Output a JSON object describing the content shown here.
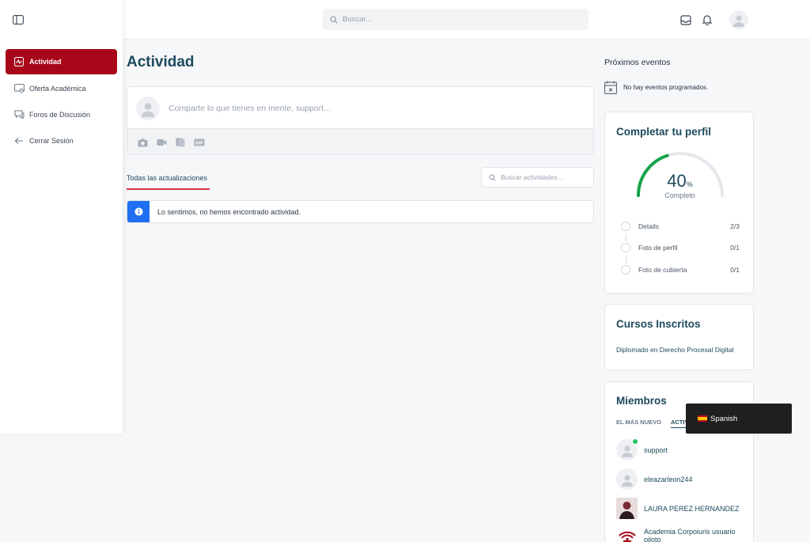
{
  "header": {
    "search_placeholder": "Buscar..."
  },
  "sidebar": {
    "items": [
      {
        "label": "Actividad",
        "icon": "activity-icon",
        "active": true
      },
      {
        "label": "Oferta Académica",
        "icon": "school-icon",
        "active": false
      },
      {
        "label": "Foros de Discusión",
        "icon": "chat-icon",
        "active": false
      },
      {
        "label": "Cerrar Sesión",
        "icon": "arrow-left-icon",
        "active": false
      }
    ]
  },
  "main": {
    "title": "Actividad",
    "post_placeholder": "Comparte lo que tienes en mente, support...",
    "tab_label": "Todas las actualizaciones",
    "search_activity_placeholder": "Buscar actividades...",
    "alert_text": "Lo sentimos, no hemos encontrado actividad."
  },
  "events": {
    "title": "Próximos eventos",
    "empty_text": "No hay eventos programados."
  },
  "profile": {
    "title": "Completar tu perfil",
    "percent": "40",
    "percent_sign": "%",
    "sub": "Completo",
    "progress_fraction": 0.4,
    "steps": [
      {
        "label": "Details",
        "count": "2/3"
      },
      {
        "label": "Foto de perfil",
        "count": "0/1"
      },
      {
        "label": "Foto de cubierta",
        "count": "0/1"
      }
    ]
  },
  "courses": {
    "title": "Cursos Inscritos",
    "items": [
      "Diplomado en Derecho Procesal Digital"
    ]
  },
  "members": {
    "title": "Miembros",
    "tabs": [
      "EL MÁS NUEVO",
      "ACTIV"
    ],
    "list": [
      {
        "name": "support",
        "online": true
      },
      {
        "name": "eleazarleon244",
        "online": false
      },
      {
        "name": "LAURA PEREZ HERNANDEZ",
        "online": false
      },
      {
        "name": "Academia Corpoiuris usuario piloto",
        "online": false
      }
    ]
  },
  "language": {
    "label": "Spanish"
  },
  "colors": {
    "accent": "#a8071a",
    "title": "#1d4a5c",
    "progress": "#16a34a",
    "info": "#1e6ff2"
  }
}
